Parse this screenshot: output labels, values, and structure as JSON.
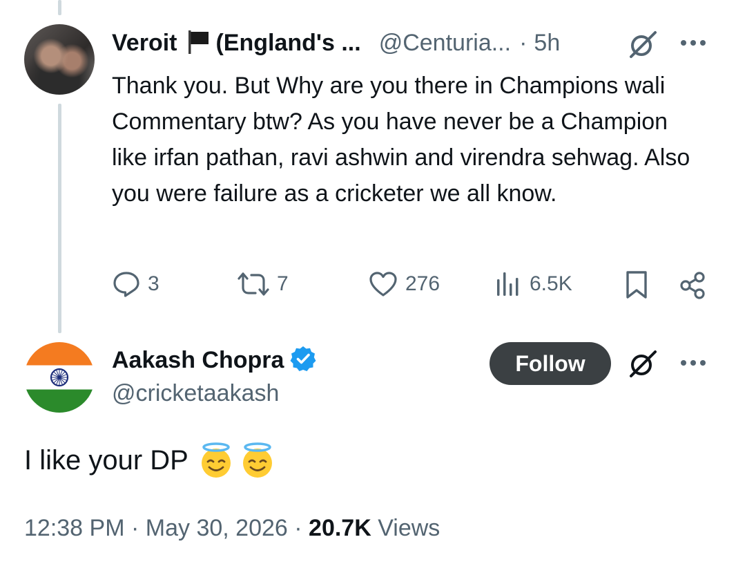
{
  "reply_tweet": {
    "display_name": "Veroit",
    "flag_icon": "black-flag-icon",
    "display_name_suffix": "(England's ...",
    "handle": "@Centuria...",
    "separator": "·",
    "time_ago": "5h",
    "text": "Thank you. But Why are you there in Champions wali Commentary btw? As you have never be a Champion like irfan pathan, ravi ashwin and virendra sehwag. Also you were failure as a cricketer we all know.",
    "actions": {
      "replies": "3",
      "reposts": "7",
      "likes": "276",
      "views": "6.5K"
    }
  },
  "main_tweet": {
    "display_name": "Aakash Chopra",
    "verified": true,
    "handle": "@cricketaakash",
    "follow_label": "Follow",
    "text": "I like your DP",
    "emojis": [
      "smiling-face-with-halo",
      "smiling-face-with-halo"
    ],
    "time": "12:38 PM",
    "separator": "·",
    "date": "May 30, 2026",
    "views_count": "20.7K",
    "views_label": "Views"
  },
  "colors": {
    "text": "#0f1419",
    "muted": "#536471",
    "verified_blue": "#1d9bf0",
    "follow_bg": "#3b4043",
    "thread_line": "#cfd9de"
  }
}
